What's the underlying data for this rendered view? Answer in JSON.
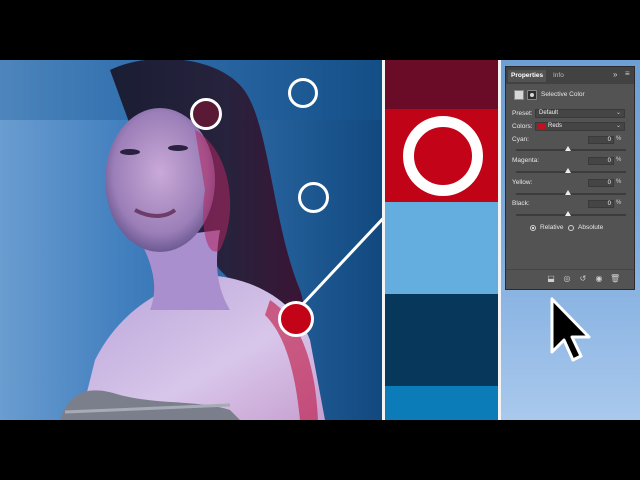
{
  "properties_panel": {
    "tabs": [
      {
        "label": "Properties",
        "active": true
      },
      {
        "label": "Info",
        "active": false
      }
    ],
    "adjustment_title": "Selective Color",
    "preset_label": "Preset:",
    "preset_value": "Default",
    "colors_label": "Colors:",
    "colors_value": "Reds",
    "colors_swatch": "#c0121e",
    "sliders": [
      {
        "label": "Cyan:",
        "value": "0",
        "unit": "%",
        "level": 0.5
      },
      {
        "label": "Magenta:",
        "value": "0",
        "unit": "%",
        "level": 0.5
      },
      {
        "label": "Yellow:",
        "value": "0",
        "unit": "%",
        "level": 0.5
      },
      {
        "label": "Black:",
        "value": "0",
        "unit": "%",
        "level": 0.5
      }
    ],
    "method_options": [
      {
        "label": "Relative",
        "selected": true
      },
      {
        "label": "Absolute",
        "selected": false
      }
    ],
    "bottom_icons": [
      "clip-to-layer-icon",
      "view-previous-icon",
      "reset-icon",
      "visibility-eye-icon",
      "trash-icon"
    ]
  },
  "swatches": [
    {
      "name": "maroon",
      "color": "#6a0b28"
    },
    {
      "name": "red",
      "color": "#c10317"
    },
    {
      "name": "light-blue",
      "color": "#63aede"
    },
    {
      "name": "navy",
      "color": "#07385c"
    },
    {
      "name": "blue",
      "color": "#0c7cb8"
    }
  ],
  "accent_colors": {
    "marker_red": "#c20318",
    "marker_dark": "#5a1a36",
    "background_blue": "#2a6ea8"
  }
}
